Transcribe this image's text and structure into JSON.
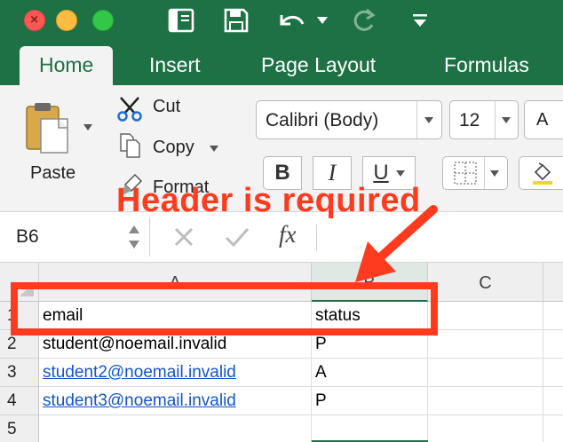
{
  "quick_access": {
    "icons": [
      "sidebar-icon",
      "save-icon",
      "undo-icon",
      "redo-icon",
      "customize-icon"
    ]
  },
  "tabs": [
    {
      "label": "Home",
      "active": true
    },
    {
      "label": "Insert",
      "active": false
    },
    {
      "label": "Page Layout",
      "active": false
    },
    {
      "label": "Formulas",
      "active": false
    }
  ],
  "clipboard": {
    "paste_label": "Paste",
    "cut_label": "Cut",
    "copy_label": "Copy",
    "format_label": "Format"
  },
  "font": {
    "name": "Calibri (Body)",
    "size": "12",
    "bold": "B",
    "italic": "I",
    "underline": "U"
  },
  "formula_bar": {
    "name_box": "B6",
    "fx": "fx",
    "value": ""
  },
  "grid": {
    "columns": [
      "A",
      "B",
      "C"
    ],
    "rows": [
      {
        "num": "1",
        "email": "email",
        "status": "status",
        "email_link": false
      },
      {
        "num": "2",
        "email": "student@noemail.invalid",
        "status": "P",
        "email_link": false
      },
      {
        "num": "3",
        "email": "student2@noemail.invalid",
        "status": "A",
        "email_link": true
      },
      {
        "num": "4",
        "email": "student3@noemail.invalid",
        "status": "P",
        "email_link": true
      },
      {
        "num": "5",
        "email": "",
        "status": "",
        "email_link": false
      }
    ]
  },
  "annotation": {
    "text": "Header is required",
    "color": "#ff3b1f"
  },
  "colors": {
    "excel_green": "#1e7145",
    "link_blue": "#1155cc"
  }
}
